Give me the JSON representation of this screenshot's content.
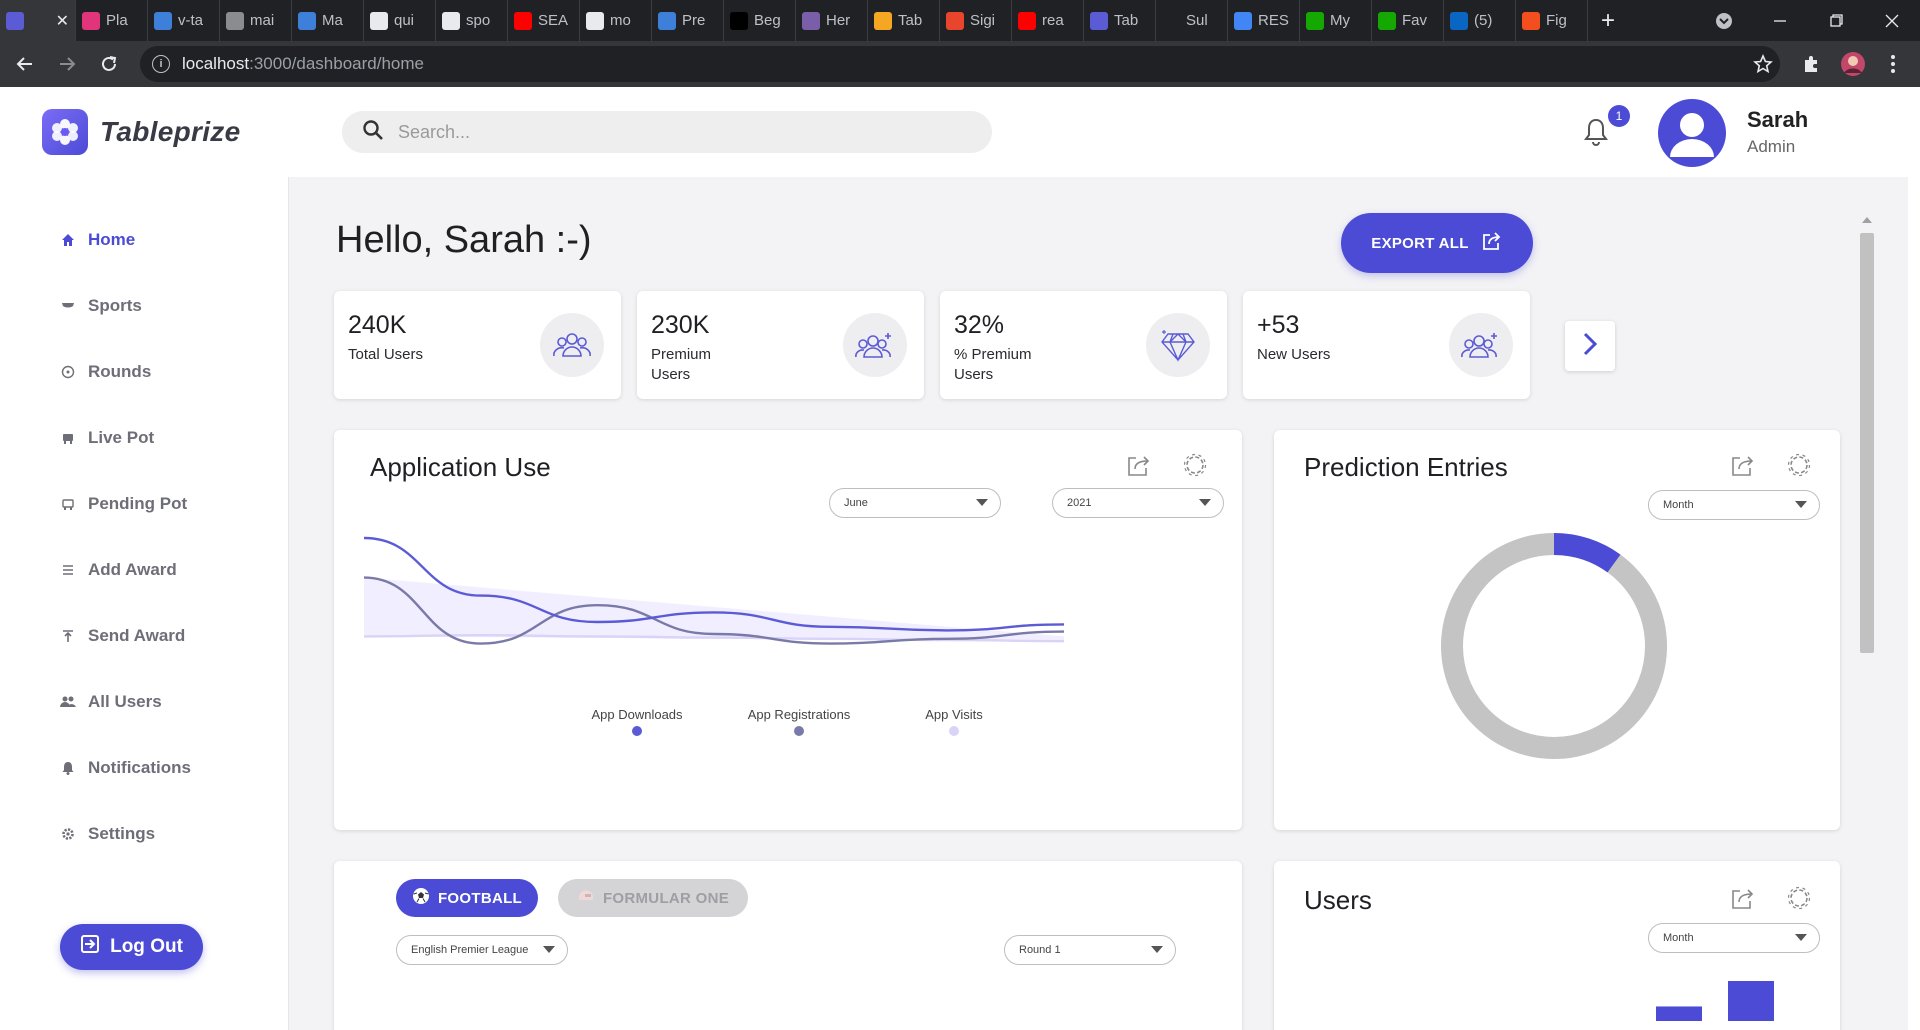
{
  "browser": {
    "tabs": [
      {
        "title": "",
        "active": true,
        "icon": "chart-favicon",
        "color": "#5b5bd6"
      },
      {
        "title": "Pla",
        "icon": "play-favicon",
        "color": "#e0347b"
      },
      {
        "title": "v-ta",
        "icon": "v-favicon",
        "color": "#3d7fd9"
      },
      {
        "title": "mai",
        "icon": "globe-favicon",
        "color": "#8a8c90"
      },
      {
        "title": "Ma",
        "icon": "m-favicon",
        "color": "#3d7fd9"
      },
      {
        "title": "qui",
        "icon": "github-favicon",
        "color": "#e8eaed"
      },
      {
        "title": "spo",
        "icon": "github-favicon",
        "color": "#e8eaed"
      },
      {
        "title": "SEA",
        "icon": "youtube-favicon",
        "color": "#ff0000"
      },
      {
        "title": "mo",
        "icon": "github-favicon",
        "color": "#e8eaed"
      },
      {
        "title": "Pre",
        "icon": "star-favicon",
        "color": "#3d7fd9"
      },
      {
        "title": "Beg",
        "icon": "dev-favicon",
        "color": "#000000"
      },
      {
        "title": "Her",
        "icon": "h-favicon",
        "color": "#7a5ea8"
      },
      {
        "title": "Tab",
        "icon": "firebase-favicon",
        "color": "#f5a623"
      },
      {
        "title": "Sigi",
        "icon": "sig-favicon",
        "color": "#e8452c"
      },
      {
        "title": "rea",
        "icon": "youtube-favicon",
        "color": "#ff0000"
      },
      {
        "title": "Tab",
        "icon": "chart-favicon",
        "color": "#5b5bd6"
      },
      {
        "title": "Sul",
        "icon": "blank-favicon",
        "color": "#202124"
      },
      {
        "title": "RES",
        "icon": "docs-favicon",
        "color": "#4285f4"
      },
      {
        "title": "My",
        "icon": "upwork-favicon",
        "color": "#14a800"
      },
      {
        "title": "Fav",
        "icon": "upwork-favicon",
        "color": "#14a800"
      },
      {
        "title": "(5)",
        "icon": "linkedin-favicon",
        "color": "#0a66c2"
      },
      {
        "title": "Fig",
        "icon": "figma-favicon",
        "color": "#f24e1e"
      }
    ],
    "url_host": "localhost",
    "url_path": ":3000/dashboard/home"
  },
  "app": {
    "brand": "Tableprize",
    "search_placeholder": "Search...",
    "notification_count": "1",
    "user": {
      "name": "Sarah",
      "role": "Admin"
    },
    "nav": [
      {
        "label": "Home",
        "icon": "home-icon",
        "active": true
      },
      {
        "label": "Sports",
        "icon": "sports-icon"
      },
      {
        "label": "Rounds",
        "icon": "rounds-icon"
      },
      {
        "label": "Live Pot",
        "icon": "live-pot-icon"
      },
      {
        "label": "Pending Pot",
        "icon": "pending-pot-icon"
      },
      {
        "label": "Add Award",
        "icon": "add-award-icon"
      },
      {
        "label": "Send Award",
        "icon": "send-award-icon"
      },
      {
        "label": "All Users",
        "icon": "users-icon"
      },
      {
        "label": "Notifications",
        "icon": "bell-icon"
      },
      {
        "label": "Settings",
        "icon": "gear-icon"
      }
    ],
    "logout_label": "Log Out",
    "accent": "#4b4bd6"
  },
  "main": {
    "greeting": "Hello, Sarah :-)",
    "export_label": "EXPORT ALL",
    "stats": [
      {
        "value": "240K",
        "label": "Total Users",
        "icon": "users-group-icon"
      },
      {
        "value": "230K",
        "label": "Premium Users",
        "icon": "users-add-icon"
      },
      {
        "value": "32%",
        "label": "% Premium Users",
        "icon": "diamond-icon"
      },
      {
        "value": "+53",
        "label": "New Users",
        "icon": "users-add-icon"
      }
    ],
    "app_use": {
      "title": "Application Use",
      "month": "June",
      "year": "2021",
      "legend": [
        {
          "label": "App Downloads",
          "color": "#5b5bd6"
        },
        {
          "label": "App Registrations",
          "color": "#7a7aa8"
        },
        {
          "label": "App Visits",
          "color": "#d9d3f7"
        }
      ]
    },
    "prediction": {
      "title": "Prediction Entries",
      "period": "Month"
    },
    "sports": {
      "tabs": [
        {
          "label": "FOOTBALL",
          "active": true
        },
        {
          "label": "FORMULAR ONE",
          "active": false
        }
      ],
      "league": "English Premier League",
      "round": "Round 1"
    },
    "users": {
      "title": "Users",
      "period": "Month"
    }
  },
  "chart_data": [
    {
      "type": "line",
      "x": [
        1,
        2,
        3,
        4,
        5,
        6,
        7
      ],
      "series": [
        {
          "name": "App Downloads",
          "values": [
            100,
            52,
            30,
            38,
            26,
            23,
            28
          ],
          "color": "#5b5bd6"
        },
        {
          "name": "App Registrations",
          "values": [
            67,
            12,
            44,
            20,
            12,
            16,
            22
          ],
          "color": "#7a7aa8"
        },
        {
          "name": "App Visits",
          "values": [
            18,
            19,
            18,
            17,
            16,
            15,
            14
          ],
          "color": "#d9d3f7"
        }
      ],
      "legend_position": "bottom"
    },
    {
      "type": "pie",
      "slices": [
        {
          "label": "",
          "value": 10,
          "color": "#4b4bd6"
        },
        {
          "label": "",
          "value": 90,
          "color": "#c4c4c4"
        }
      ]
    },
    {
      "type": "bar",
      "values": [
        20,
        55
      ],
      "color": "#4b4bd6"
    }
  ]
}
